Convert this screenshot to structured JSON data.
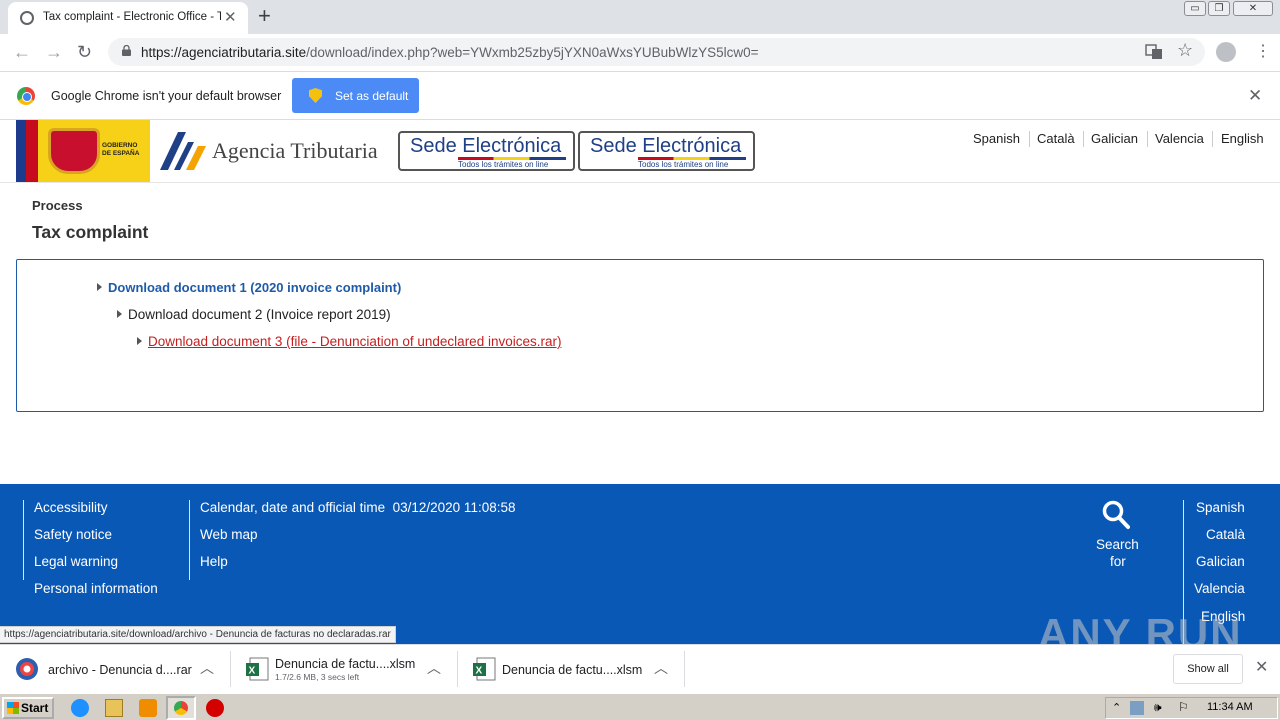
{
  "browser": {
    "tab_title": "Tax complaint - Electronic Office - Ta",
    "tab_close": "✕",
    "new_tab": "+",
    "url_host": "https://agenciatributaria.site",
    "url_path": "/download/index.php?web=YWxmb25zby5jYXN0aWxsYUBubWlzYS5lcw0=",
    "window_buttons": [
      "minimize",
      "restore",
      "close"
    ]
  },
  "infobar": {
    "message": "Google Chrome isn't your default browser",
    "button_label": "Set as default",
    "close": "✕"
  },
  "site": {
    "gobierno_label_line1": "GOBIERNO",
    "gobierno_label_line2": "DE ESPAÑA",
    "brand": "Agencia Tributaria",
    "sede_1": {
      "title": "Sede Electrónica",
      "subtitle": "Todos los trámites on line"
    },
    "sede_2": {
      "title": "Sede Electrónica",
      "subtitle": "Todos los trámites on line"
    },
    "languages": [
      "Spanish",
      "Català",
      "Galician",
      "Valencia",
      "English"
    ]
  },
  "main": {
    "section": "Process",
    "title": "Tax complaint",
    "downloads": [
      {
        "label": "Download document 1 (2020 invoice complaint)"
      },
      {
        "label": "Download document 2 (Invoice report 2019)"
      },
      {
        "label": "Download document 3 (file - Denunciation of undeclared invoices.rar)"
      }
    ]
  },
  "footer": {
    "col1": [
      "Accessibility",
      "Safety notice",
      "Legal warning",
      "Personal information"
    ],
    "col2": [
      "Calendar, date and official time  03/12/2020 11:08:58",
      "Web map",
      "Help"
    ],
    "search_line1": "Search",
    "search_line2": "for",
    "languages": [
      "Spanish",
      "Català",
      "Galician",
      "Valencia",
      "English"
    ]
  },
  "status_url": "https://agenciatributaria.site/download/archivo - Denuncia de facturas no declaradas.rar",
  "watermark": "ANY RUN",
  "download_shelf": {
    "items": [
      {
        "name": "archivo - Denuncia d....rar",
        "sub": ""
      },
      {
        "name": "Denuncia de factu....xlsm",
        "sub": "1.7/2.6 MB, 3 secs left"
      },
      {
        "name": "Denuncia de factu....xlsm",
        "sub": ""
      }
    ],
    "show_all": "Show all",
    "close": "✕"
  },
  "taskbar": {
    "start_label": "Start",
    "clock": "11:34 AM"
  },
  "colors": {
    "footer_blue": "#0a58b5",
    "link_blue": "#1f5aa8",
    "link_red": "#c41e1e",
    "chrome_button": "#4c8bf5"
  }
}
